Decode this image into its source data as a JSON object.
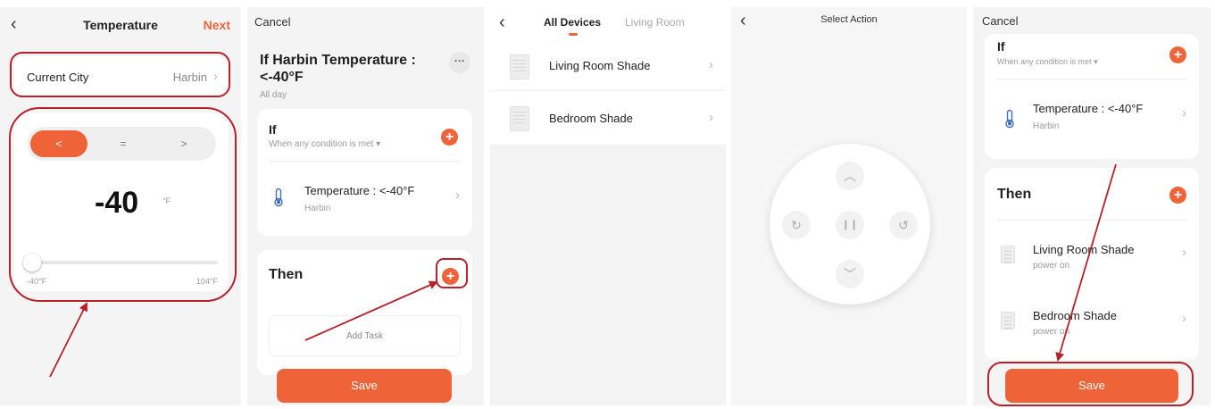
{
  "screen1": {
    "title": "Temperature",
    "next_label": "Next",
    "city_label": "Current City",
    "city_value": "Harbin",
    "operators": [
      "<",
      "=",
      ">"
    ],
    "temperature_value": "-40",
    "temperature_unit": "°F",
    "slider_min": "-40°F",
    "slider_max": "104°F",
    "slider_level": 0
  },
  "screen2": {
    "cancel_label": "Cancel",
    "scene_title": "If Harbin Temperature : <-40°F",
    "schedule": "All day",
    "if_label": "If",
    "condition_mode": "When any condition is met",
    "condition_title": "Temperature : <-40°F",
    "condition_city": "Harbin",
    "then_label": "Then",
    "add_task_label": "Add Task",
    "save_label": "Save"
  },
  "screen3": {
    "tabs": [
      "All Devices",
      "Living Room"
    ],
    "devices": [
      {
        "name": "Living Room Shade"
      },
      {
        "name": "Bedroom Shade"
      }
    ]
  },
  "screen4": {
    "title": "Select Action"
  },
  "screen5": {
    "cancel_label": "Cancel",
    "if_label": "If",
    "condition_mode": "When any condition is met",
    "condition_title": "Temperature : <-40°F",
    "condition_city": "Harbin",
    "then_label": "Then",
    "tasks": [
      {
        "name": "Living Room Shade",
        "status": "power on"
      },
      {
        "name": "Bedroom Shade",
        "status": "power on"
      }
    ],
    "save_label": "Save"
  },
  "colors": {
    "accent": "#ee6337",
    "annotation": "#b8202a",
    "background": "#f4f4f5"
  },
  "icons": {
    "thermometer": "thermometer-icon",
    "plus": "plus-icon",
    "chevron": "chevron-right-icon",
    "back": "back-arrow-icon"
  }
}
